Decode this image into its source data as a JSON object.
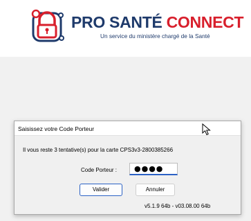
{
  "brand": {
    "word_pro": "PRO",
    "word_sante": "SANTÉ",
    "word_connect": "CONNECT",
    "tagline": "Un service du ministère chargé de la Santé",
    "logo_icon": "lock-icon",
    "colors": {
      "navy": "#1e3a6b",
      "red": "#d81f2c",
      "blue": "#1d70b8"
    }
  },
  "dialog": {
    "title": "Saisissez votre Code Porteur",
    "info": "Il vous reste 3 tentative(s) pour la carte CPS3v3-2800385266",
    "code_label": "Code Porteur :",
    "code_value": "●●●●",
    "ok_label": "Valider",
    "cancel_label": "Annuler",
    "version": "v5.1.9 64b - v03.08.00 64b",
    "accent_color": "#2b62c5"
  }
}
